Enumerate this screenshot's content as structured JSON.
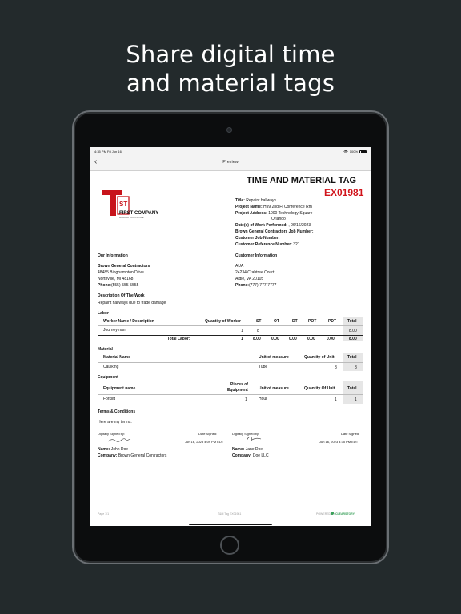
{
  "headline": {
    "line1": "Share digital time",
    "line2": "and material tags"
  },
  "status": {
    "time": "4:35 PM   Fri Jun 16",
    "battery": "100%"
  },
  "nav": {
    "back": "‹",
    "title": "Preview"
  },
  "doc": {
    "title": "TIME AND MATERIAL TAG",
    "tag_number": "EX01981",
    "logo_text": "FIRST COMPANY",
    "logo_mark": "ST",
    "logo_tagline": "BUILDING YOUR FUTURE",
    "meta": [
      {
        "label": "Title:",
        "value": "Repaint hallways"
      },
      {
        "label": "Project Name:",
        "value": "H99 2nd Fl Conference Rm"
      },
      {
        "label": "Project Address:",
        "value": "1000 Technology Square"
      },
      {
        "label": "",
        "value": "Orlando"
      },
      {
        "label": "Date(s) of Work Performed:",
        "value": ", 06/16/2023"
      },
      {
        "label": "Brown General Contractors Job Number:",
        "value": ""
      },
      {
        "label": "Customer Job Number:",
        "value": ""
      },
      {
        "label": "Customer Reference Number:",
        "value": "321"
      }
    ],
    "our_info": {
      "heading": "Our Information",
      "name": "Brown General Contractors",
      "addr1": "48485 Binghampton Drive",
      "addr2": "Northville, MI 48168",
      "phone_label": "Phone:",
      "phone": "(555)-555-5555"
    },
    "customer_info": {
      "heading": "Customer Information",
      "name": "AUA",
      "addr1": "24234 Crabtree Court",
      "addr2": "Aldie, VA 20105",
      "phone_label": "Phone:",
      "phone": "(777)-777-7777"
    },
    "work": {
      "heading": "Description Of The Work",
      "text": "Repaint hallways due to trade damage"
    },
    "labor": {
      "heading": "Labor",
      "headers": [
        "Worker Name / Description",
        "Quantity of Worker",
        "ST",
        "OT",
        "DT",
        "POT",
        "PDT",
        "Total"
      ],
      "rows": [
        [
          "Journeyman",
          "1",
          "8",
          "",
          "",
          "",
          "",
          "8.00"
        ]
      ],
      "total_row": [
        "Total Labor:",
        "1",
        "8.00",
        "0.00",
        "0.00",
        "0.00",
        "0.00",
        "8.00"
      ]
    },
    "material": {
      "heading": "Material",
      "headers": [
        "Material Name",
        "Unit of measure",
        "Quantity of Unit",
        "Total"
      ],
      "rows": [
        [
          "Caulking",
          "Tube",
          "8",
          "8"
        ]
      ]
    },
    "equipment": {
      "heading": "Equipment",
      "headers": [
        "Equipment name",
        "Pieces of",
        "Equipment",
        "Unit of measure",
        "Quantity Of Unit",
        "Total"
      ],
      "rows": [
        [
          "Forklift",
          "1",
          "Hour",
          "1",
          "1"
        ]
      ]
    },
    "terms": {
      "heading": "Terms & Conditions",
      "text": "Here are my terms."
    },
    "sign_left": {
      "signed_by": "Digitally Signed by:",
      "date_signed": "Date Signed:",
      "date": "Jun 16, 2023 4:09 PM EDT",
      "name_label": "Name:",
      "name": "John Doe",
      "company_label": "Company:",
      "company": "Brown General Contractors"
    },
    "sign_right": {
      "signed_by": "Digitally Signed by:",
      "date_signed": "Date Signed:",
      "date": "Jun 16, 2023 4:35 PM EDT",
      "name_label": "Name:",
      "name": "Jane Doe",
      "company_label": "Company:",
      "company": "Doe LLC"
    },
    "footer": {
      "page": "Page 1/1",
      "center": "T&M Tag EX01981",
      "powered": "POWERED BY",
      "brand": "CLEARSTORY"
    }
  },
  "colors": {
    "background": "#232a2c",
    "accent_red": "#d1141b",
    "total_cell": "#e6e6e6"
  }
}
